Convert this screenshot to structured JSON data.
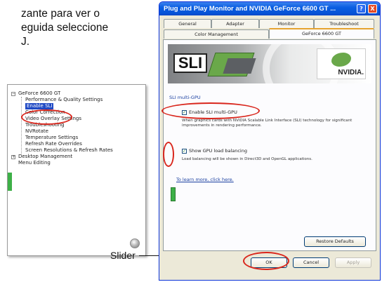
{
  "instructions": {
    "line1": "zante para ver o",
    "line2": "eguida seleccione",
    "line3": "J."
  },
  "tree": {
    "root": "GeForce 6600 GT",
    "items": [
      "Performance & Quality Settings",
      "Enable SLI",
      "Color Correction",
      "Video Overlay Settings",
      "Troubleshooting",
      "NVRotate",
      "Temperature Settings",
      "Refresh Rate Overrides",
      "Screen Resolutions & Refresh Rates"
    ],
    "desktop_management": "Desktop Management",
    "menu_editing": "Menu Editing"
  },
  "callout": {
    "slider_label": "Slider"
  },
  "dialog": {
    "title": "Plug and Play Monitor and NVIDIA GeForce 6600 GT ...",
    "help_glyph": "?",
    "close_glyph": "X",
    "tabs_row1": [
      "General",
      "Adapter",
      "Monitor",
      "Troubleshoot"
    ],
    "tabs_row2": [
      "Color Management",
      "GeForce 6600 GT"
    ],
    "banner": {
      "sli_text": "SLI",
      "nvidia_text": "NVIDIA."
    },
    "group_label": "SLI multi-GPU",
    "enable_sli_label": "Enable SLI multi-GPU",
    "enable_sli_desc": "When graphics cards with NVIDIA Scalable Link Interface (SLI) technology for significant improvements in rendering performance.",
    "show_balancing_label": "Show GPU load balancing",
    "show_balancing_desc": "Load balancing will be shown in Direct3D and OpenGL applications.",
    "learn_link": "To learn more, click here.",
    "restore_defaults": "Restore Defaults",
    "ok": "OK",
    "cancel": "Cancel",
    "apply": "Apply"
  },
  "colors": {
    "annotation_red": "#d9261c",
    "xp_blue": "#0a5ee2",
    "nvidia_green": "#6aa84a",
    "selection_blue": "#1f49c4"
  }
}
